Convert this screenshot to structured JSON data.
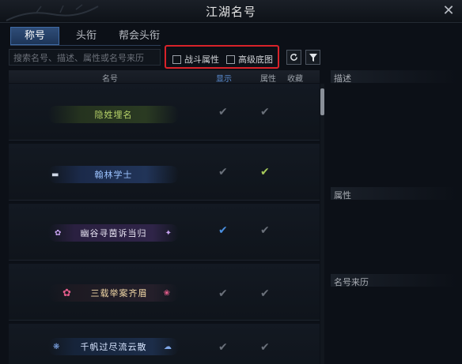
{
  "window": {
    "title": "江湖名号",
    "close_glyph": "✕"
  },
  "tabs": [
    {
      "label": "称号",
      "active": true
    },
    {
      "label": "头衔",
      "active": false
    },
    {
      "label": "帮会头衔",
      "active": false
    }
  ],
  "search": {
    "placeholder": "搜索名号、描述、属性或名号来历"
  },
  "filters": {
    "combat_attr": {
      "label": "战斗属性",
      "checked": false
    },
    "premium_bg": {
      "label": "高级底图",
      "checked": false
    }
  },
  "toolbar": {
    "refresh_icon": "refresh-icon",
    "filter_icon": "funnel-icon"
  },
  "list": {
    "headers": {
      "name": "名号",
      "display": "显示",
      "attr": "属性",
      "fav": "收藏"
    },
    "rows": [
      {
        "name": "隐姓埋名",
        "display": "grey",
        "attr": "grey"
      },
      {
        "name": "翰林学士",
        "display": "grey",
        "attr": "green"
      },
      {
        "name": "幽谷寻茵诉当归",
        "display": "blue",
        "attr": "grey"
      },
      {
        "name": "三载举案齐眉",
        "display": "grey",
        "attr": "grey"
      },
      {
        "name": "千帆过尽流云散",
        "display": "grey",
        "attr": "grey"
      }
    ]
  },
  "detail": {
    "desc_label": "描述",
    "attr_label": "属性",
    "origin_label": "名号来历"
  },
  "colors": {
    "accent_tab": "#2f4d78",
    "highlight_border": "#d9232a",
    "check_green": "#a6c95a",
    "check_blue": "#4a8fe0",
    "check_grey": "#6a707a"
  }
}
